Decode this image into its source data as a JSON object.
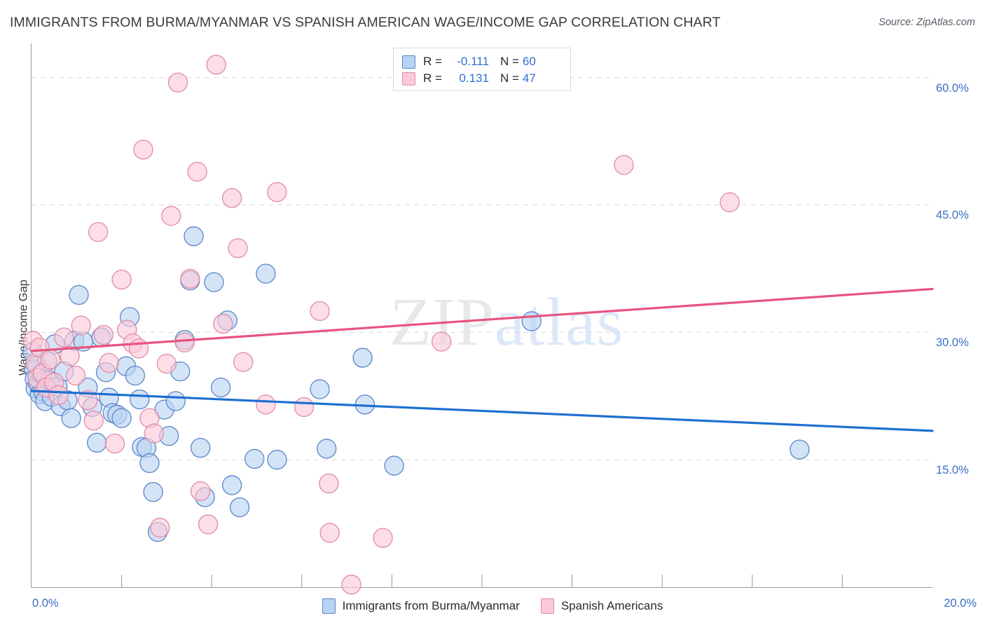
{
  "header": {
    "title": "IMMIGRANTS FROM BURMA/MYANMAR VS SPANISH AMERICAN WAGE/INCOME GAP CORRELATION CHART",
    "source": "Source: ZipAtlas.com"
  },
  "watermark": {
    "zip": "ZIP",
    "atlas": "atlas"
  },
  "stats": {
    "rows": [
      {
        "series": "Immigrants from Burma/Myanmar",
        "r_label": "R =",
        "r_value": "-0.111",
        "n_label": "N =",
        "n_value": "60",
        "color": "#b9d3f2"
      },
      {
        "series": "Spanish Americans",
        "r_label": "R =",
        "r_value": "0.131",
        "n_label": "N =",
        "n_value": "47",
        "color": "#fbc9d8"
      }
    ]
  },
  "legend": {
    "items": [
      {
        "label": "Immigrants from Burma/Myanmar",
        "color": "#b9d3f2"
      },
      {
        "label": "Spanish Americans",
        "color": "#fbc9d8"
      }
    ]
  },
  "chart_data": {
    "type": "scatter",
    "title": "IMMIGRANTS FROM BURMA/MYANMAR VS SPANISH AMERICAN WAGE/INCOME GAP CORRELATION CHART",
    "xlabel": "",
    "ylabel": "Wage/Income Gap",
    "xlim": [
      0.0,
      20.0
    ],
    "ylim": [
      0.0,
      64.0
    ],
    "x_tick_labels": [
      "0.0%",
      "20.0%"
    ],
    "x_tick_values": [
      0.0,
      20.0
    ],
    "x_minor_ticks": [
      2.0,
      4.0,
      6.0,
      8.0,
      10.0,
      12.0,
      14.0,
      16.0,
      18.0
    ],
    "y_tick_labels": [
      "60.0%",
      "45.0%",
      "30.0%",
      "15.0%"
    ],
    "y_tick_values": [
      60.0,
      45.0,
      30.0,
      15.0
    ],
    "grid": "horizontal-dashed",
    "legend_position": "bottom-center",
    "colors": {
      "blue_fill": "#b9d3f2",
      "blue_stroke": "#5b87c9",
      "pink_fill": "#fbc9d8",
      "pink_stroke": "#e08ba6",
      "blue_line": "#1e6fd0",
      "pink_line": "#e8537f",
      "axis": "#9a9a9a",
      "grid": "#d9d9d9",
      "tick_text": "#3d6fc4"
    },
    "series": [
      {
        "name": "Immigrants from Burma/Myanmar",
        "r": -0.111,
        "n": 60,
        "fill": "#b9d3f2",
        "stroke": "#5b87c9",
        "trendline": {
          "color": "#1e6fd0",
          "x0": 0.0,
          "y0": 23.1,
          "x1": 20.0,
          "y1": 18.4
        },
        "points": [
          [
            0.02,
            27.7
          ],
          [
            0.05,
            25.6
          ],
          [
            0.07,
            24.5
          ],
          [
            0.09,
            23.4
          ],
          [
            0.12,
            26.1
          ],
          [
            0.15,
            24.0
          ],
          [
            0.18,
            22.7
          ],
          [
            0.22,
            25.1
          ],
          [
            0.26,
            23.0
          ],
          [
            0.3,
            21.9
          ],
          [
            0.35,
            26.6
          ],
          [
            0.4,
            24.3
          ],
          [
            0.45,
            22.4
          ],
          [
            0.52,
            28.6
          ],
          [
            0.58,
            23.6
          ],
          [
            0.65,
            21.3
          ],
          [
            0.72,
            25.4
          ],
          [
            0.8,
            22.0
          ],
          [
            0.88,
            19.9
          ],
          [
            0.95,
            29.0
          ],
          [
            1.05,
            34.4
          ],
          [
            1.15,
            28.9
          ],
          [
            1.25,
            23.5
          ],
          [
            1.35,
            21.2
          ],
          [
            1.45,
            17.0
          ],
          [
            1.55,
            29.4
          ],
          [
            1.65,
            25.3
          ],
          [
            1.72,
            22.3
          ],
          [
            1.8,
            20.5
          ],
          [
            1.9,
            20.3
          ],
          [
            2.0,
            19.9
          ],
          [
            2.1,
            26.0
          ],
          [
            2.18,
            31.8
          ],
          [
            2.3,
            24.9
          ],
          [
            2.4,
            22.1
          ],
          [
            2.45,
            16.5
          ],
          [
            2.55,
            16.4
          ],
          [
            2.62,
            14.6
          ],
          [
            2.7,
            11.2
          ],
          [
            2.8,
            6.5
          ],
          [
            2.95,
            20.9
          ],
          [
            3.05,
            17.8
          ],
          [
            3.2,
            21.9
          ],
          [
            3.3,
            25.4
          ],
          [
            3.4,
            29.1
          ],
          [
            3.52,
            36.1
          ],
          [
            3.6,
            41.3
          ],
          [
            3.75,
            16.4
          ],
          [
            3.85,
            10.6
          ],
          [
            4.05,
            35.9
          ],
          [
            4.2,
            23.5
          ],
          [
            4.35,
            31.4
          ],
          [
            4.45,
            12.0
          ],
          [
            4.62,
            9.4
          ],
          [
            4.95,
            15.1
          ],
          [
            5.2,
            36.9
          ],
          [
            5.45,
            15.0
          ],
          [
            6.4,
            23.3
          ],
          [
            6.55,
            16.3
          ],
          [
            7.35,
            27.0
          ],
          [
            7.4,
            21.5
          ],
          [
            8.05,
            14.3
          ],
          [
            11.1,
            31.3
          ],
          [
            17.05,
            16.2
          ]
        ]
      },
      {
        "name": "Spanish Americans",
        "r": 0.131,
        "n": 47,
        "fill": "#fbc9d8",
        "stroke": "#e08ba6",
        "trendline": {
          "color": "#e8537f",
          "x0": 0.0,
          "y0": 27.8,
          "x1": 20.0,
          "y1": 35.1
        },
        "points": [
          [
            0.03,
            29.0
          ],
          [
            0.08,
            26.3
          ],
          [
            0.13,
            24.6
          ],
          [
            0.18,
            28.2
          ],
          [
            0.25,
            25.2
          ],
          [
            0.33,
            23.5
          ],
          [
            0.42,
            26.8
          ],
          [
            0.5,
            24.1
          ],
          [
            0.6,
            22.6
          ],
          [
            0.72,
            29.4
          ],
          [
            0.85,
            27.2
          ],
          [
            0.98,
            24.9
          ],
          [
            1.1,
            30.8
          ],
          [
            1.25,
            22.0
          ],
          [
            1.38,
            19.6
          ],
          [
            1.48,
            41.8
          ],
          [
            1.6,
            29.7
          ],
          [
            1.72,
            26.4
          ],
          [
            1.85,
            16.9
          ],
          [
            2.0,
            36.2
          ],
          [
            2.12,
            30.3
          ],
          [
            2.25,
            28.7
          ],
          [
            2.38,
            28.1
          ],
          [
            2.48,
            51.5
          ],
          [
            2.62,
            19.9
          ],
          [
            2.72,
            18.1
          ],
          [
            2.85,
            7.0
          ],
          [
            3.0,
            26.3
          ],
          [
            3.1,
            43.7
          ],
          [
            3.25,
            59.4
          ],
          [
            3.4,
            28.8
          ],
          [
            3.52,
            36.3
          ],
          [
            3.68,
            48.9
          ],
          [
            3.75,
            11.3
          ],
          [
            3.92,
            7.4
          ],
          [
            4.1,
            61.5
          ],
          [
            4.25,
            31.0
          ],
          [
            4.45,
            45.8
          ],
          [
            4.58,
            39.9
          ],
          [
            4.7,
            26.5
          ],
          [
            5.2,
            21.5
          ],
          [
            5.45,
            46.5
          ],
          [
            6.05,
            21.2
          ],
          [
            6.4,
            32.5
          ],
          [
            6.6,
            12.2
          ],
          [
            6.62,
            6.4
          ],
          [
            7.1,
            0.3
          ],
          [
            7.8,
            5.8
          ],
          [
            9.1,
            28.9
          ],
          [
            13.15,
            49.7
          ],
          [
            15.5,
            45.3
          ]
        ]
      }
    ]
  }
}
